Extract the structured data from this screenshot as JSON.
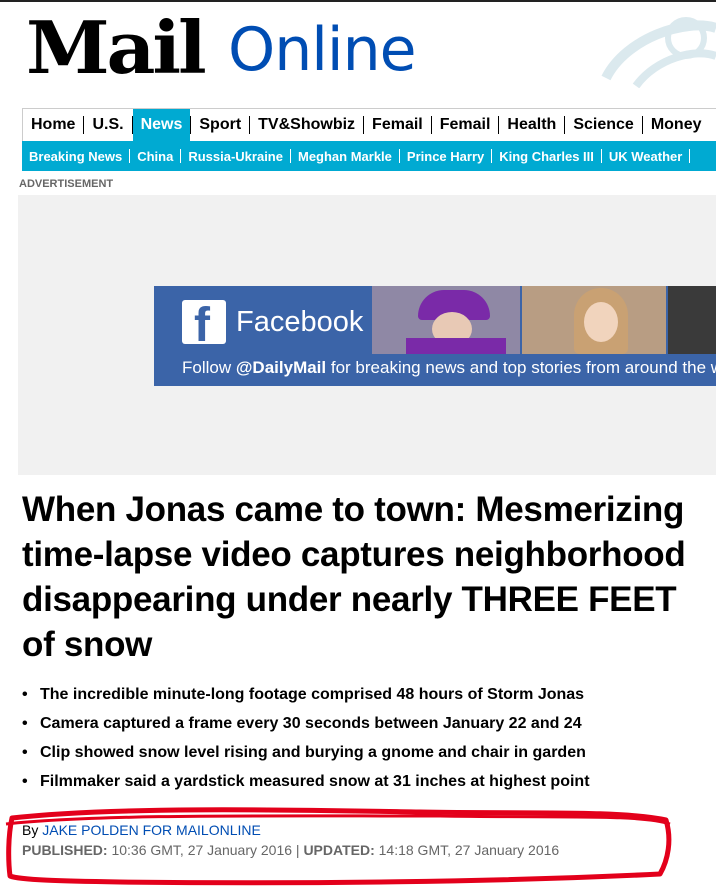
{
  "brand": {
    "logo_part1": "Mail",
    "logo_part2": "Online"
  },
  "nav_primary": [
    "Home",
    "U.S.",
    "News",
    "Sport",
    "TV&Showbiz",
    "Femail",
    "Femail",
    "Health",
    "Science",
    "Money"
  ],
  "nav_primary_active": "News",
  "nav_secondary": [
    "Breaking News",
    "China",
    "Russia-Ukraine",
    "Meghan Markle",
    "Prince Harry",
    "King Charles III",
    "UK Weather"
  ],
  "ad": {
    "label": "ADVERTISEMENT",
    "fb_letter": "f",
    "fb_title": "Facebook",
    "follow_prefix": "Follow ",
    "follow_handle": "@DailyMail",
    "follow_suffix": " for breaking news and top stories from around the world"
  },
  "article": {
    "headline": "When Jonas came to town: Mesmerizing time-lapse video captures neighborhood disappearing under nearly THREE FEET of snow",
    "bullets": [
      "The incredible minute-long footage comprised 48 hours of Storm Jonas",
      "Camera captured a frame every 30 seconds between January 22 and 24",
      "Clip showed snow level rising and burying a gnome and chair in garden",
      "Filmmaker said a yardstick measured snow at 31 inches at highest point"
    ],
    "byline_prefix": "By ",
    "author": "JAKE POLDEN FOR MAILONLINE",
    "published_label": "PUBLISHED:",
    "published_value": " 10:36 GMT, 27 January 2016",
    "divider": " | ",
    "updated_label": "UPDATED:",
    "updated_value": " 14:18 GMT, 27 January 2016"
  },
  "colors": {
    "accent": "#00aad2",
    "brand_blue": "#004db3",
    "facebook_blue": "#3b64a8",
    "annotation_red": "#e3001b"
  }
}
